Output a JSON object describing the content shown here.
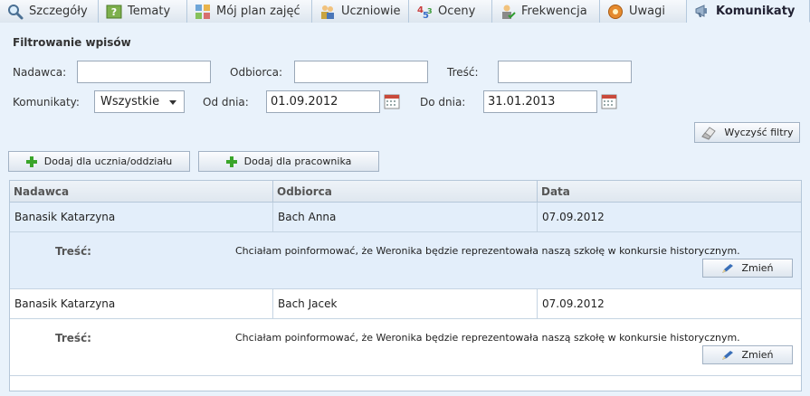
{
  "tabs": [
    {
      "label": "Szczegóły",
      "icon": "magnifier-icon"
    },
    {
      "label": "Tematy",
      "icon": "topics-icon"
    },
    {
      "label": "Mój plan zajęć",
      "icon": "schedule-icon"
    },
    {
      "label": "Uczniowie",
      "icon": "students-icon"
    },
    {
      "label": "Oceny",
      "icon": "grades-icon"
    },
    {
      "label": "Frekwencja",
      "icon": "attendance-icon"
    },
    {
      "label": "Uwagi",
      "icon": "remarks-icon"
    },
    {
      "label": "Komunikaty",
      "icon": "megaphone-icon"
    }
  ],
  "filters": {
    "title": "Filtrowanie wpisów",
    "sender_label": "Nadawca:",
    "sender_value": "",
    "recipient_label": "Odbiorca:",
    "recipient_value": "",
    "content_label": "Treść:",
    "content_value": "",
    "messages_label": "Komunikaty:",
    "messages_value": "Wszystkie",
    "from_label": "Od dnia:",
    "from_value": "01.09.2012",
    "to_label": "Do dnia:",
    "to_value": "31.01.2013",
    "clear_label": "Wyczyść filtry"
  },
  "actions": {
    "add_student": "Dodaj dla ucznia/oddziału",
    "add_employee": "Dodaj dla pracownika"
  },
  "table": {
    "headers": [
      "Nadawca",
      "Odbiorca",
      "Data"
    ],
    "content_label": "Treść:",
    "edit_label": "Zmień",
    "rows": [
      {
        "sender": "Banasik Katarzyna",
        "recipient": "Bach Anna",
        "date": "07.09.2012",
        "content": "Chciałam poinformować, że Weronika będzie reprezentowała naszą szkołę w konkursie historycznym."
      },
      {
        "sender": "Banasik Katarzyna",
        "recipient": "Bach Jacek",
        "date": "07.09.2012",
        "content": "Chciałam poinformować, że Weronika będzie reprezentowała naszą szkołę w konkursie historycznym."
      }
    ]
  },
  "colors": {
    "accent": "#e9f2fb",
    "selected_row": "#e3eefa",
    "plus_green": "#3aa52a"
  }
}
